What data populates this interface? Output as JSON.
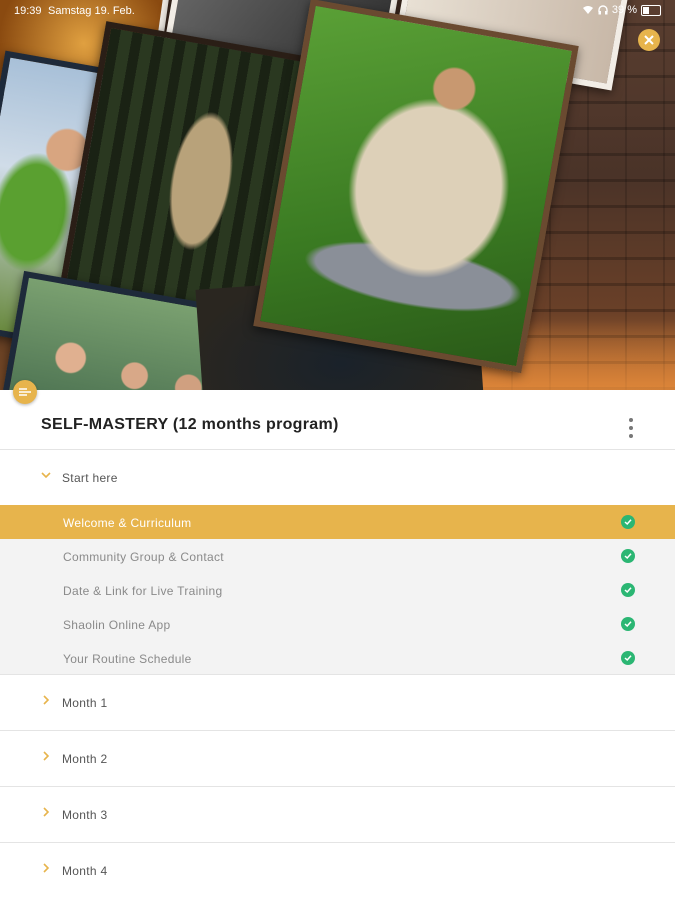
{
  "status_bar": {
    "time": "19:39",
    "date": "Samstag 19. Feb.",
    "battery": "39 %"
  },
  "course": {
    "title": "SELF-MASTERY (12 months program)"
  },
  "sections": [
    {
      "label": "Start here",
      "expanded": true,
      "lessons": [
        {
          "title": "Welcome & Curriculum",
          "completed": true,
          "active": true
        },
        {
          "title": "Community Group & Contact",
          "completed": true,
          "active": false
        },
        {
          "title": "Date & Link for Live Training",
          "completed": true,
          "active": false
        },
        {
          "title": "Shaolin Online App",
          "completed": true,
          "active": false
        },
        {
          "title": "Your Routine Schedule",
          "completed": true,
          "active": false
        }
      ]
    },
    {
      "label": "Month 1",
      "expanded": false
    },
    {
      "label": "Month 2",
      "expanded": false
    },
    {
      "label": "Month 3",
      "expanded": false
    },
    {
      "label": "Month 4",
      "expanded": false
    }
  ],
  "icons": {
    "close": "close-icon",
    "menu": "more-vert-icon",
    "check": "check-circle-icon",
    "chevron": "chevron-icon"
  },
  "colors": {
    "accent": "#e7b44c",
    "check": "#2bb673",
    "active_text": "#ffffff",
    "muted_text": "#8a8a8a"
  }
}
